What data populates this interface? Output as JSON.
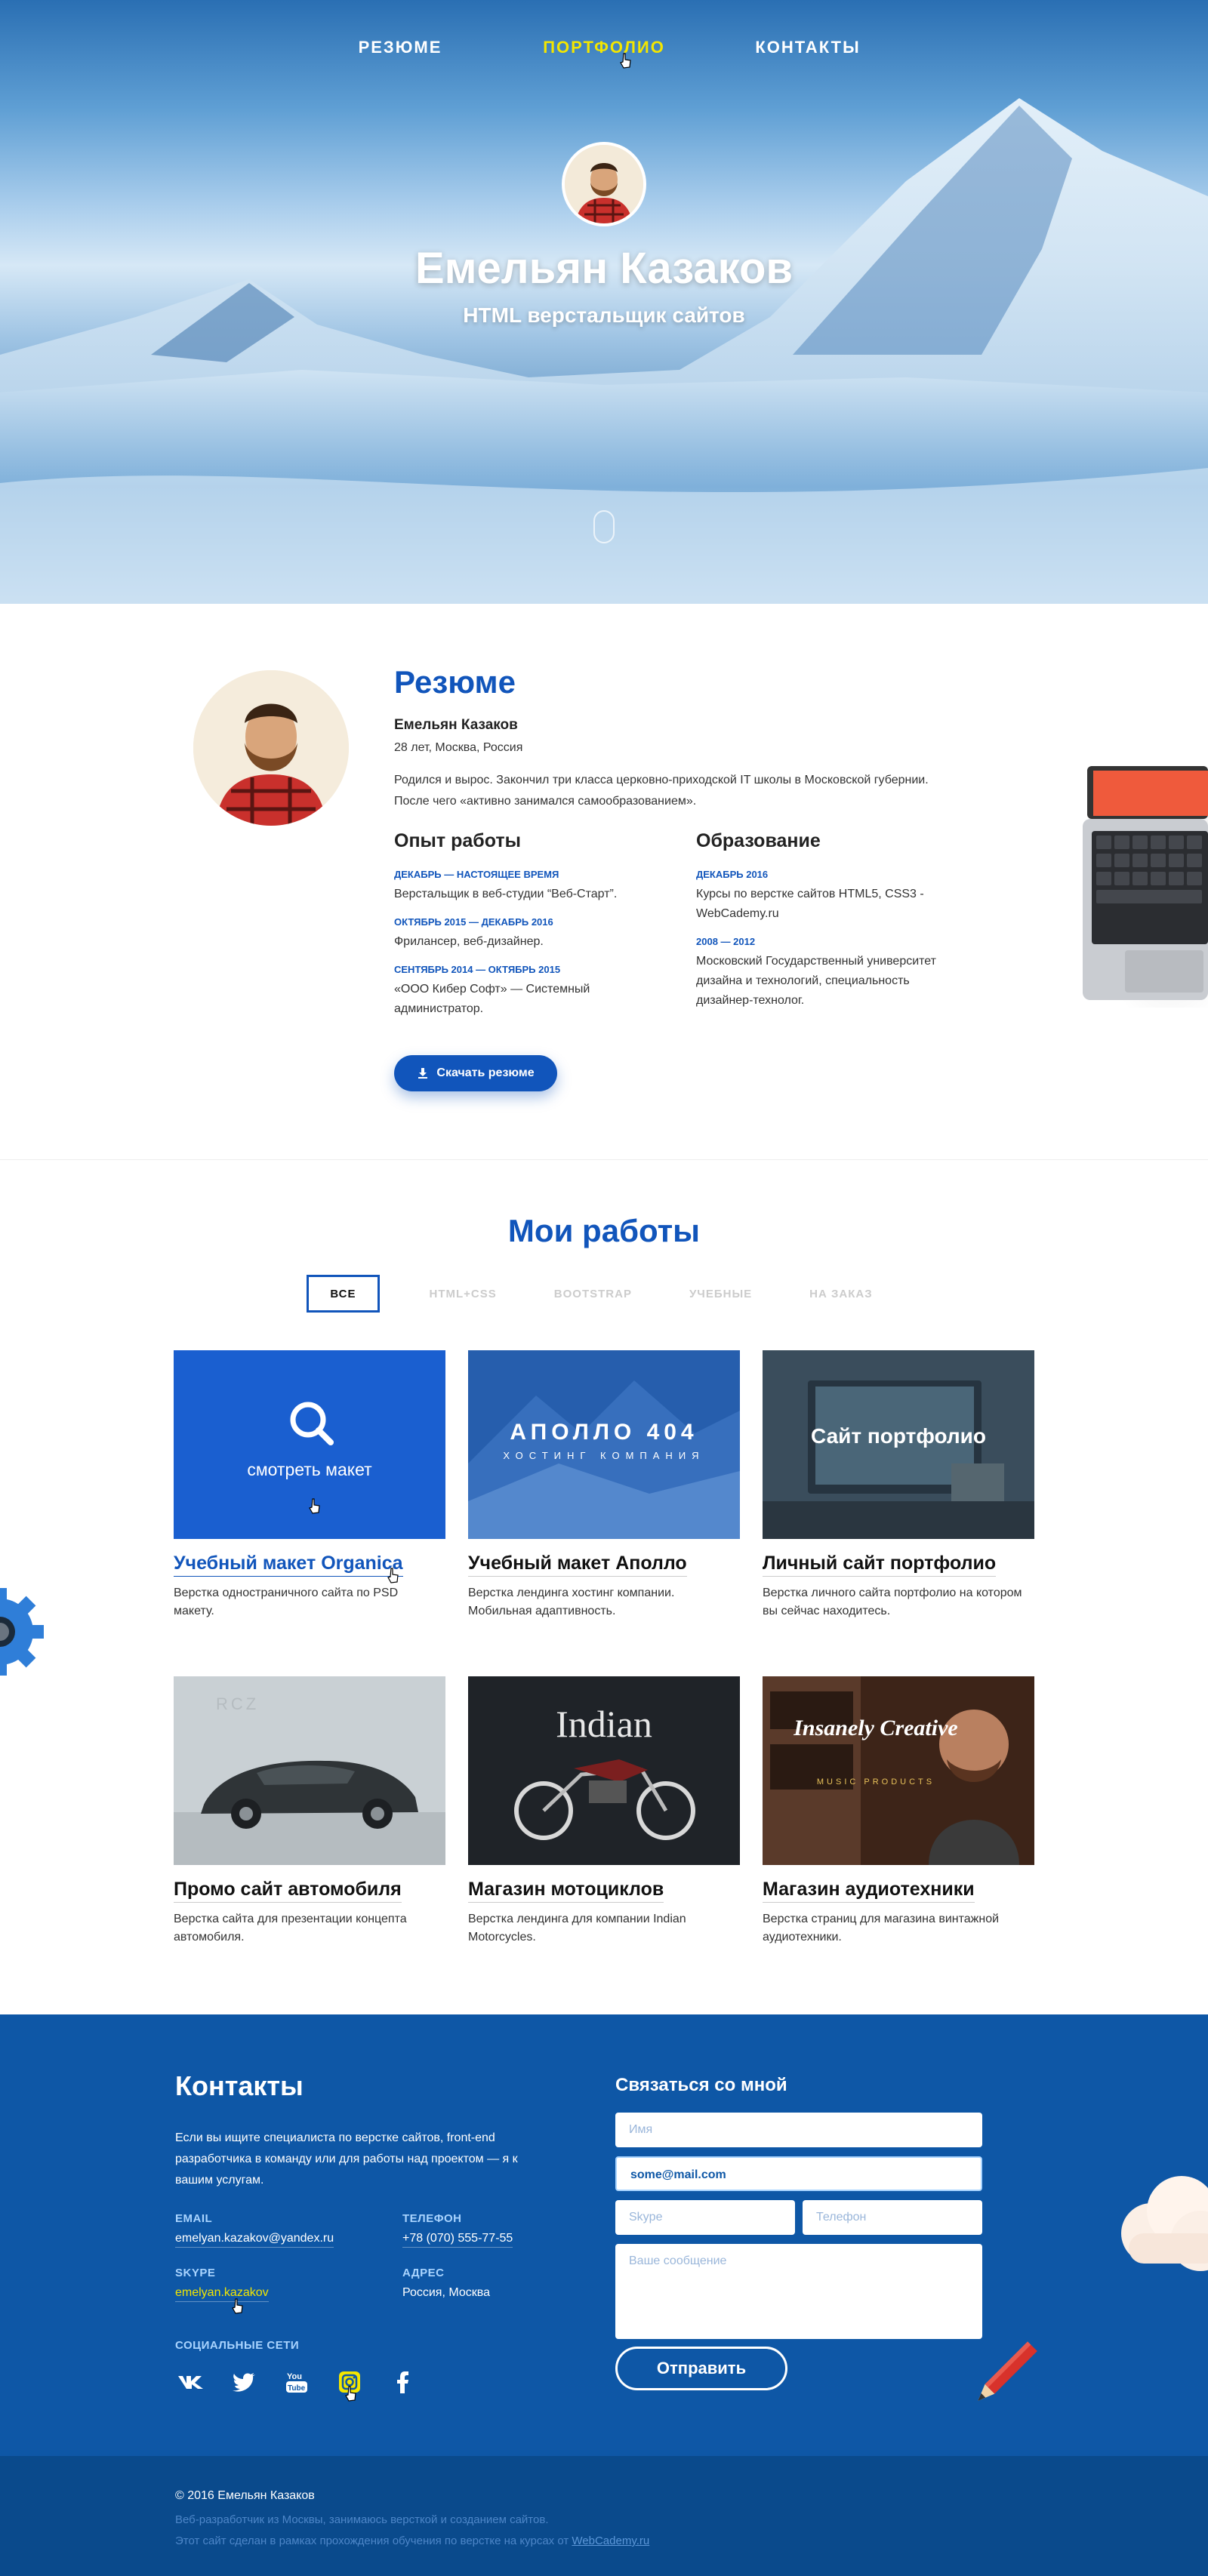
{
  "nav": {
    "items": [
      {
        "label": "РЕЗЮМЕ",
        "active": false
      },
      {
        "label": "ПОРТФОЛИО",
        "active": true
      },
      {
        "label": "КОНТАКТЫ",
        "active": false
      }
    ]
  },
  "hero": {
    "name": "Емельян Казаков",
    "subtitle": "HTML верстальщик сайтов"
  },
  "resume": {
    "title": "Резюме",
    "name": "Емельян Казаков",
    "age_city": "28 лет, Москва, Россия",
    "bio_line1": "Родился и вырос. Закончил три класса церковно-приходской IT школы в Московской губернии.",
    "bio_line2": "После чего «активно занимался самообразованием».",
    "experience": {
      "title": "Опыт работы",
      "items": [
        {
          "date": "ДЕКАБРЬ — НАСТОЯЩЕЕ ВРЕМЯ",
          "text": "Верстальщик в веб-студии “Веб-Старт”."
        },
        {
          "date": "ОКТЯБРЬ 2015 — ДЕКАБРЬ 2016",
          "text": "Фрилансер, веб-дизайнер."
        },
        {
          "date": "СЕНТЯБРЬ 2014 — ОКТЯБРЬ 2015",
          "text": "«ООО Кибер Софт» — Системный администратор."
        }
      ]
    },
    "education": {
      "title": "Образование",
      "items": [
        {
          "date": "ДЕКАБРЬ 2016",
          "text": "Курсы по верстке сайтов HTML5, CSS3 - WebCademy.ru"
        },
        {
          "date": "2008 — 2012",
          "text": "Московский Государственный университет дизайна и технологий, специальность дизайнер-технолог."
        }
      ]
    },
    "download_label": "Скачать резюме"
  },
  "works": {
    "title": "Мои работы",
    "filters": [
      {
        "label": "ВСЕ",
        "active": true
      },
      {
        "label": "HTML+CSS",
        "active": false
      },
      {
        "label": "BOOTSTRAP",
        "active": false
      },
      {
        "label": "УЧЕБНЫЕ",
        "active": false
      },
      {
        "label": "НА ЗАКАЗ",
        "active": false
      }
    ],
    "hover_label": "смотреть макет",
    "cards": [
      {
        "title": "Учебный макет Organica",
        "desc": "Верстка одностраничного сайта по PSD макету."
      },
      {
        "title": "Учебный макет Аполло",
        "desc": "Верстка лендинга хостинг компании. Мобильная адаптивность.",
        "thumb_main": "АПОЛЛО 404",
        "thumb_sub": "ХОСТИНГ КОМПАНИЯ"
      },
      {
        "title": "Личный сайт портфолио",
        "desc": "Верстка личного сайта портфолио на котором вы сейчас находитесь.",
        "thumb_main": "Сайт портфолио"
      },
      {
        "title": "Промо сайт автомобиля",
        "desc": "Верстка сайта для презентации концепта автомобиля.",
        "thumb_main": "RCZ"
      },
      {
        "title": "Магазин мотоциклов",
        "desc": "Верстка лендинга для компании Indian Motorcycles.",
        "thumb_main": "Indian"
      },
      {
        "title": "Магазин аудиотехники",
        "desc": "Верстка страниц для магазина винтажной аудиотехники.",
        "thumb_main": "Insanely Creative",
        "thumb_sub": "MUSIC PRODUCTS"
      }
    ]
  },
  "contacts": {
    "title": "Контакты",
    "text": "Если вы ищите специалиста по верстке сайтов, front-end разработчика в команду или для работы над проектом — я к вашим услугам.",
    "email_label": "EMAIL",
    "email": "emelyan.kazakov@yandex.ru",
    "phone_label": "ТЕЛЕФОН",
    "phone": "+78 (070) 555-77-55",
    "skype_label": "SKYPE",
    "skype": "emelyan.kazakov",
    "address_label": "АДРЕС",
    "address": "Россия, Москва",
    "social_label": "СОЦИАЛЬНЫЕ СЕТИ",
    "form": {
      "title": "Связаться со мной",
      "name_placeholder": "Имя",
      "email_value": "some@mail.com",
      "skype_placeholder": "Skype",
      "phone_placeholder": "Телефон",
      "message_placeholder": "Ваше сообщение",
      "send_label": "Отправить"
    }
  },
  "footer": {
    "copyright": "© 2016 Емельян Казаков",
    "line1": "Веб-разработчик из Москвы, занимаюсь версткой и созданием сайтов.",
    "line2_prefix": "Этот сайт сделан в рамках прохождения обучения по верстке на курсах от ",
    "line2_link": "WebCademy.ru"
  },
  "colors": {
    "accent": "#1155bb",
    "nav_active": "#f3e600",
    "contacts_bg": "#0e57a6",
    "footer_bg": "#0a4a8c"
  }
}
